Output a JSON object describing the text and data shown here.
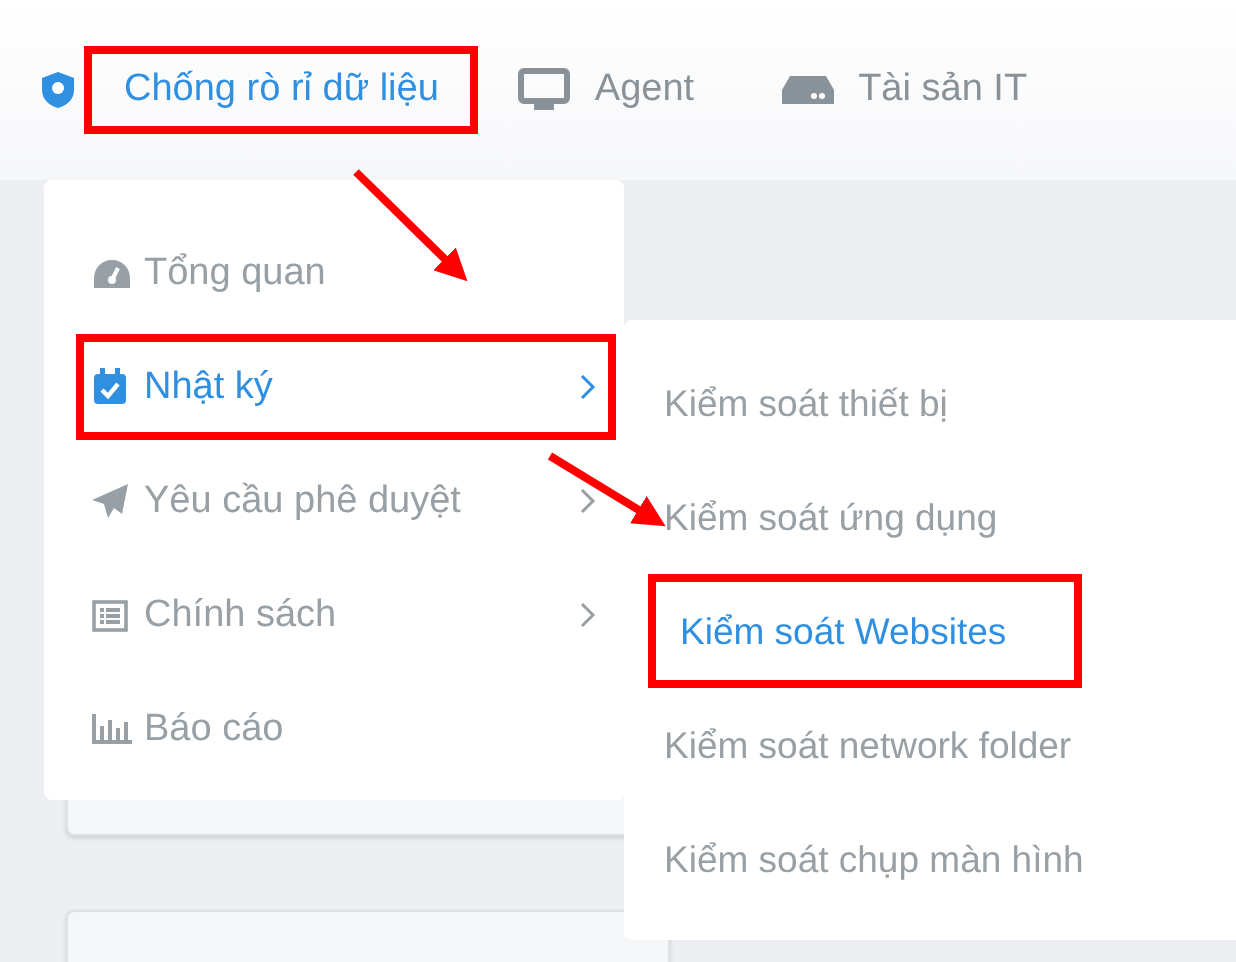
{
  "top_nav": [
    {
      "label": "Chống rò rỉ dữ liệu",
      "selected": true,
      "highlighted": true
    },
    {
      "label": "Agent",
      "selected": false,
      "highlighted": false
    },
    {
      "label": "Tài sản IT",
      "selected": false,
      "highlighted": false
    }
  ],
  "menu": [
    {
      "label": "Tổng quan",
      "selected": false,
      "has_submenu": false,
      "highlighted": false
    },
    {
      "label": "Nhật ký",
      "selected": true,
      "has_submenu": true,
      "highlighted": true
    },
    {
      "label": "Yêu cầu phê duyệt",
      "selected": false,
      "has_submenu": true,
      "highlighted": false
    },
    {
      "label": "Chính sách",
      "selected": false,
      "has_submenu": true,
      "highlighted": false
    },
    {
      "label": "Báo cáo",
      "selected": false,
      "has_submenu": false,
      "highlighted": false
    }
  ],
  "submenu": [
    {
      "label": "Kiểm soát thiết bị",
      "selected": false,
      "highlighted": false
    },
    {
      "label": "Kiểm soát ứng dụng",
      "selected": false,
      "highlighted": false
    },
    {
      "label": "Kiểm soát Websites",
      "selected": true,
      "highlighted": true
    },
    {
      "label": "Kiểm soát network folder",
      "selected": false,
      "highlighted": false
    },
    {
      "label": "Kiểm soát chụp màn hình",
      "selected": false,
      "highlighted": false
    }
  ]
}
